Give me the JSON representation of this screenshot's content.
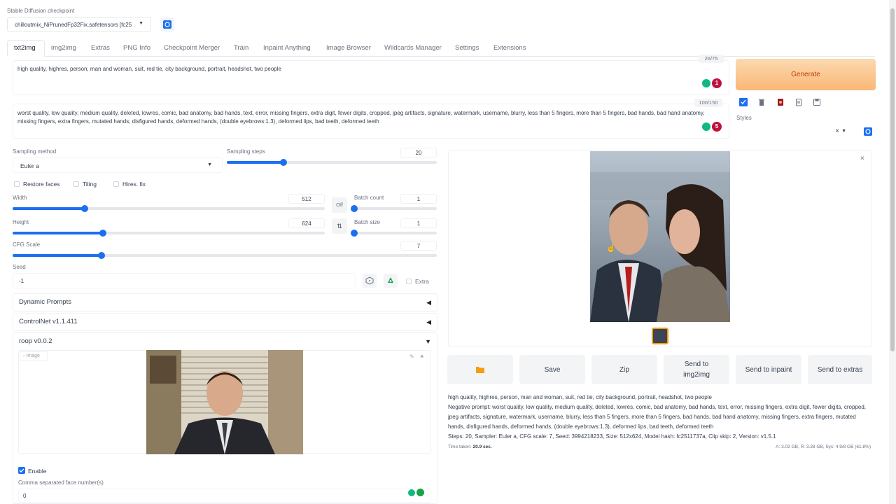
{
  "checkpoint": {
    "label": "Stable Diffusion checkpoint",
    "value": "chilloutmix_NiPrunedFp32Fix.safetensors [fc25"
  },
  "tabs": [
    "txt2img",
    "img2img",
    "Extras",
    "PNG Info",
    "Checkpoint Merger",
    "Train",
    "Inpaint Anything",
    "Image Browser",
    "Wildcards Manager",
    "Settings",
    "Extensions"
  ],
  "prompt": {
    "counter": "26/75",
    "text": "high quality, highres, person, man and woman, suit, red tie, city background, portrait, headshot, two people",
    "badge": "1"
  },
  "negative": {
    "counter": "100/150",
    "text": "worst quality, low quality, medium quality, deleted, lowres, comic, bad anatomy, bad hands, text, error, missing fingers, extra digit, fewer digits, cropped, jpeg artifacts, signature, watermark, username, blurry, less than 5 fingers, more than 5 fingers, bad hands, bad hand anatomy, missing fingers, extra fingers, mutated hands, disfigured hands, deformed hands, (double eyebrows:1.3), deformed lips, bad teeth, deformed teeth",
    "badge": "5"
  },
  "generate_label": "Generate",
  "styles_label": "Styles",
  "sampling": {
    "method_label": "Sampling method",
    "method_value": "Euler a",
    "steps_label": "Sampling steps",
    "steps_value": "20",
    "steps_frac": 0.27
  },
  "checks": {
    "restore_faces": "Restore faces",
    "tiling": "Tiling",
    "hires": "Hires. fix"
  },
  "width": {
    "label": "Width",
    "value": "512",
    "frac": 0.23
  },
  "height": {
    "label": "Height",
    "value": "624",
    "frac": 0.29
  },
  "swap_off": "Off",
  "batch_count": {
    "label": "Batch count",
    "value": "1",
    "frac": 0.0
  },
  "batch_size": {
    "label": "Batch size",
    "value": "1",
    "frac": 0.0
  },
  "cfg": {
    "label": "CFG Scale",
    "value": "7",
    "frac": 0.21
  },
  "seed": {
    "label": "Seed",
    "value": "-1",
    "extra": "Extra"
  },
  "accordions": {
    "dynamic": "Dynamic Prompts",
    "controlnet": "ControlNet v1.1.411",
    "roop": "roop v0.0.2"
  },
  "roop": {
    "image_label": "Image",
    "enable_label": "Enable",
    "face_label": "Comma separated face number(s)",
    "face_value": "0"
  },
  "actions": {
    "folder": "folder-icon",
    "save": "Save",
    "zip": "Zip",
    "img2img": "Send to img2img",
    "inpaint": "Send to inpaint",
    "extras": "Send to extras"
  },
  "info": {
    "prompt": "high quality, highres, person, man and woman, suit, red tie, city background, portrait, headshot, two people",
    "negative": "Negative prompt: worst quality, low quality, medium quality, deleted, lowres, comic, bad anatomy, bad hands, text, error, missing fingers, extra digit, fewer digits, cropped, jpeg artifacts, signature, watermark, username, blurry, less than 5 fingers, more than 5 fingers, bad hands, bad hand anatomy, missing fingers, extra fingers, mutated hands, disfigured hands, deformed hands, (double eyebrows:1.3), deformed lips, bad teeth, deformed teeth",
    "params": "Steps: 20, Sampler: Euler a, CFG scale: 7, Seed: 3994218233, Size: 512x624, Model hash: fc2511737a, Clip skip: 2, Version: v1.5.1",
    "time_label": "Time taken:",
    "time_value": "20.9 sec.",
    "vram": "A: 3.02 GB, R: 3.38 GB, Sys: 4.9/8 GB (61.8%)"
  },
  "colors": {
    "accent": "#1d6ff2",
    "generate_from": "#fcd9b0",
    "generate_to": "#f9b776",
    "generate_text": "#c2410c"
  }
}
